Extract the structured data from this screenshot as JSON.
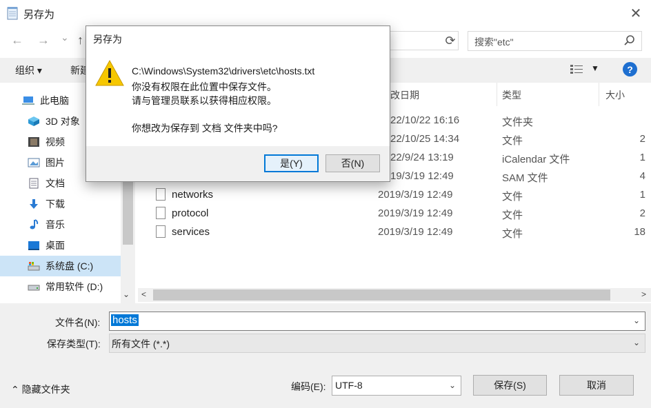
{
  "window": {
    "title": "另存为",
    "close_glyph": "✕"
  },
  "nav": {
    "back_glyph": "←",
    "forward_glyph": "→",
    "down_glyph": "⌄",
    "up_glyph": "↑",
    "search_placeholder": "搜索\"etc\""
  },
  "toolbar": {
    "organize_label": "组织 ▾",
    "newfolder_label": "新建",
    "help_glyph": "?"
  },
  "sidebar": {
    "items": [
      {
        "label": "此电脑"
      },
      {
        "label": "3D 对象"
      },
      {
        "label": "视频"
      },
      {
        "label": "图片"
      },
      {
        "label": "文档"
      },
      {
        "label": "下载"
      },
      {
        "label": "音乐"
      },
      {
        "label": "桌面"
      },
      {
        "label": "系统盘 (C:)"
      },
      {
        "label": "常用软件 (D:)"
      }
    ]
  },
  "files": {
    "headers": {
      "date": "改日期",
      "type": "类型",
      "size": "大小"
    },
    "rows": [
      {
        "name": "",
        "date": "22/10/22 16:16",
        "type": "文件夹",
        "size": ""
      },
      {
        "name": "",
        "date": "22/10/25 14:34",
        "type": "文件",
        "size": "2"
      },
      {
        "name": "",
        "date": "22/9/24 13:19",
        "type": "iCalendar 文件",
        "size": "1"
      },
      {
        "name": "",
        "date": "19/3/19 12:49",
        "type": "SAM 文件",
        "size": "4"
      },
      {
        "name": "networks",
        "date": "2019/3/19 12:49",
        "type": "文件",
        "size": "1"
      },
      {
        "name": "protocol",
        "date": "2019/3/19 12:49",
        "type": "文件",
        "size": "2"
      },
      {
        "name": "services",
        "date": "2019/3/19 12:49",
        "type": "文件",
        "size": "18"
      }
    ]
  },
  "form": {
    "filename_label": "文件名(N):",
    "filename_value": "hosts",
    "filetype_label": "保存类型(T):",
    "filetype_value": "所有文件  (*.*)",
    "hide_folders_label": "隐藏文件夹",
    "encoding_label": "编码(E):",
    "encoding_value": "UTF-8",
    "save_label": "保存(S)",
    "cancel_label": "取消"
  },
  "modal": {
    "title": "另存为",
    "line1": "C:\\Windows\\System32\\drivers\\etc\\hosts.txt",
    "line2": "你没有权限在此位置中保存文件。",
    "line3": "请与管理员联系以获得相应权限。",
    "line4": "你想改为保存到 文档 文件夹中吗?",
    "yes_label": "是(Y)",
    "no_label": "否(N)"
  },
  "colors": {
    "accent": "#0078d7",
    "selected_bg": "#cce4f7",
    "warning": "#f6c700"
  }
}
